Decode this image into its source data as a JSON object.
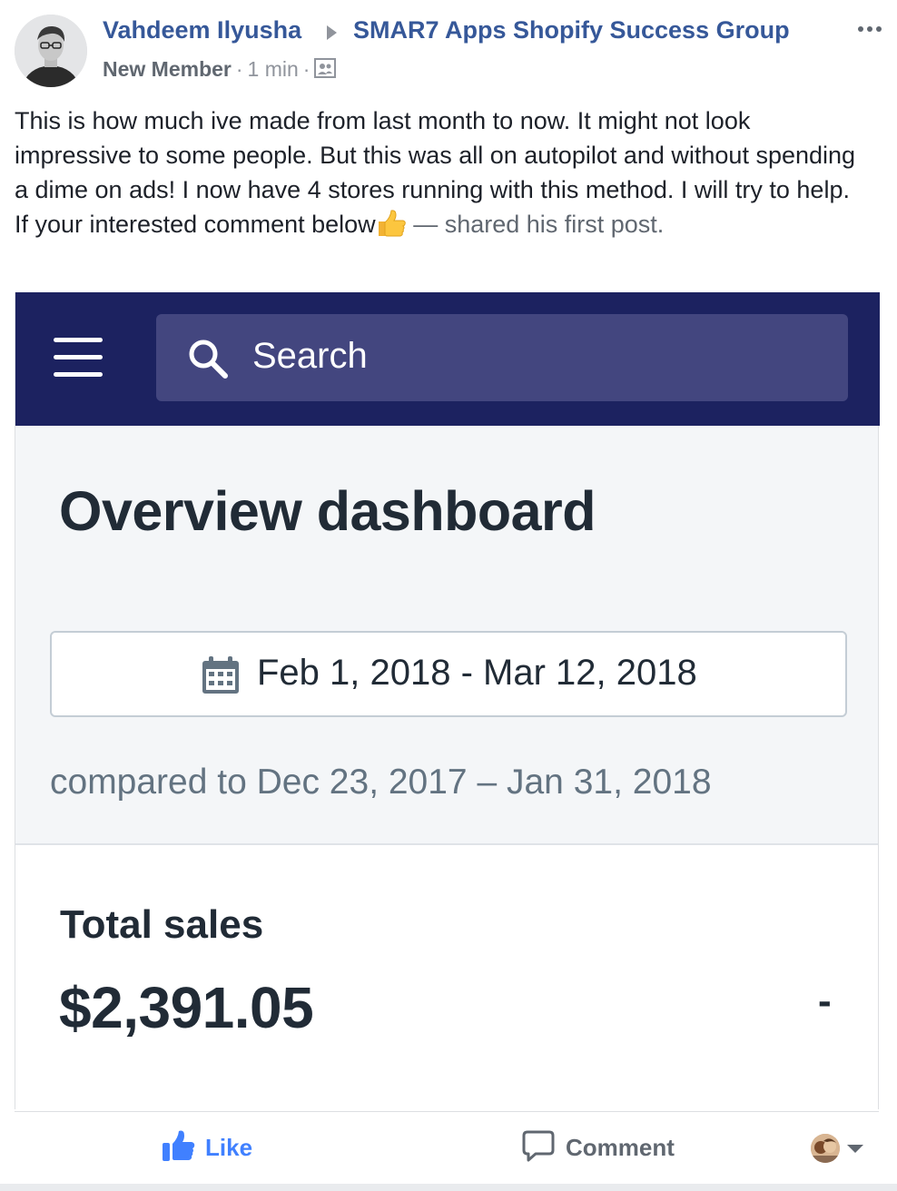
{
  "post": {
    "author": "Vahdeem Ilyusha",
    "group": "SMAR7 Apps Shopify Success Group",
    "badge": "New Member",
    "separator": "·",
    "time": "1 min",
    "privacy_icon": "members-only-group-icon",
    "text_main": "This is how much ive made from last month to now. It might not look impressive to some people. But this was all on autopilot and without spending a dime on ads! I now have 4 stores running with this method. I will try to help. If your interested comment below",
    "emoji": "thumbs-up-emoji",
    "shared_text": "— shared his first post."
  },
  "screenshot": {
    "search_placeholder": "Search",
    "title": "Overview dashboard",
    "date_range": "Feb 1, 2018 - Mar 12, 2018",
    "compared_to": "compared to Dec 23, 2017 – Jan 31, 2018",
    "card_title": "Total sales",
    "card_value": "$2,391.05",
    "card_change": "-",
    "colors": {
      "topbar": "#1c2260",
      "searchbox": "#43467f"
    }
  },
  "actions": {
    "like_label": "Like",
    "comment_label": "Comment"
  },
  "colors": {
    "link": "#365899",
    "like": "#4080ff",
    "muted": "#90949c"
  }
}
